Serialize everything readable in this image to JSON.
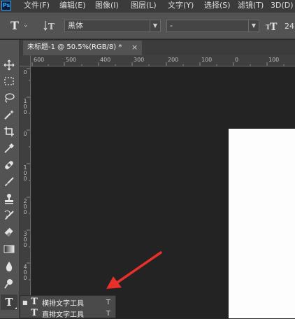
{
  "app": {
    "logo": "Ps"
  },
  "menu": [
    {
      "label": "文件(F)"
    },
    {
      "label": "编辑(E)"
    },
    {
      "label": "图像(I)"
    },
    {
      "label": "图层(L)"
    },
    {
      "label": "文字(Y)"
    },
    {
      "label": "选择(S)"
    },
    {
      "label": "滤镜(T)"
    },
    {
      "label": "3D(D)"
    }
  ],
  "options_bar": {
    "tool_icon": "text-tool-icon",
    "font_family": "黑体",
    "font_style": "-",
    "font_size": "24"
  },
  "document": {
    "tab_title": "未标题-1 @ 50.5%(RGB/8) *",
    "close": "×"
  },
  "ruler": {
    "horizontal": [
      "600",
      "500",
      "400",
      "300",
      "200",
      "100",
      "0",
      "100"
    ],
    "vertical": [
      "0",
      "1\n0\n0",
      "0",
      "1\n0\n0",
      "2\n0\n0",
      "3\n0\n0",
      "4\n0\n0"
    ]
  },
  "tools": [
    "move-icon",
    "marquee-icon",
    "lasso-icon",
    "magic-wand-icon",
    "crop-icon",
    "eyedropper-icon",
    "healing-brush-icon",
    "brush-icon",
    "clone-stamp-icon",
    "history-brush-icon",
    "eraser-icon",
    "gradient-icon",
    "blur-icon",
    "dodge-icon",
    "text-tool-icon"
  ],
  "text_tool": {
    "label": "T"
  },
  "flyout": [
    {
      "label": "横排文字工具",
      "shortcut": "T",
      "active": true
    },
    {
      "label": "直排文字工具",
      "shortcut": "T",
      "active": false
    }
  ],
  "colors": {
    "arrow": "#e8302a",
    "canvas": "#232323",
    "document": "#fdfdfd"
  }
}
